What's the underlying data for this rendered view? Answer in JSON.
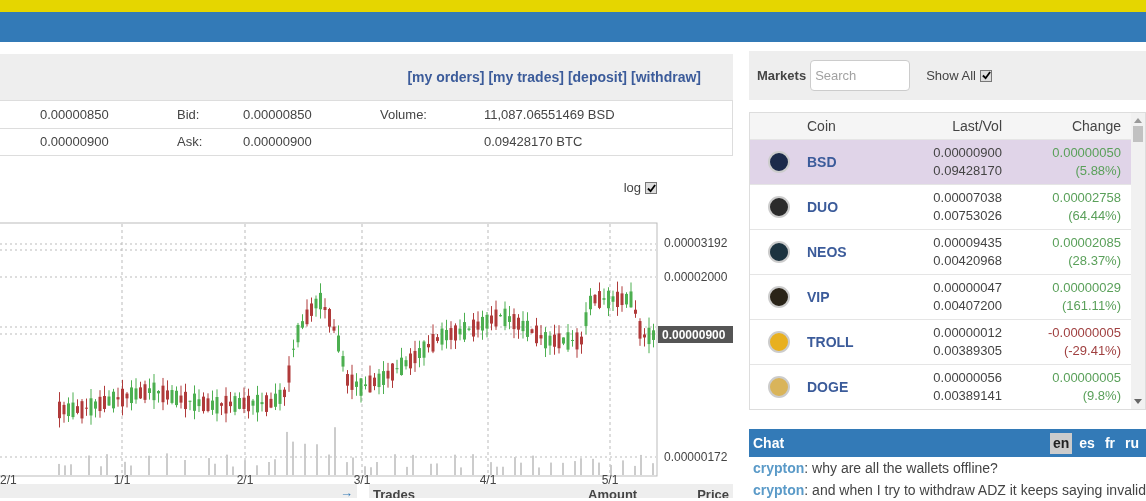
{
  "top_links": [
    {
      "label": "[my orders]"
    },
    {
      "label": "[my trades]"
    },
    {
      "label": "[deposit]"
    },
    {
      "label": "[withdraw]"
    }
  ],
  "ticker_rows": [
    {
      "col_1": "0.00000850",
      "label": "Bid:",
      "value": "0.00000850",
      "label_2": "Volume:",
      "amount": "11,087.06551469 BSD"
    },
    {
      "col_1": "0.00000900",
      "label": "Ask:",
      "value": "0.00000900",
      "label_2": "",
      "amount": "0.09428170 BTC"
    }
  ],
  "chart": {
    "log_label": "log",
    "log_checked": true,
    "y_ticks": [
      "0.00003192",
      "0.00002000",
      "0.00000172"
    ],
    "current_price": "0.00000900",
    "x_ticks": [
      "2/1",
      "1/1",
      "2/1",
      "3/1",
      "4/1",
      "5/1"
    ]
  },
  "bottom_bar": {
    "arrow": "→",
    "columns": [
      "Trades",
      "Amount",
      "Price"
    ]
  },
  "markets": {
    "title": "Markets",
    "search_placeholder": "Search",
    "show_all_label": "Show All",
    "show_all_checked": true
  },
  "coin_table": {
    "columns": [
      "Coin",
      "Last/Vol",
      "Change"
    ],
    "rows": [
      {
        "coin": "BSD",
        "last": "0.00000900",
        "vol": "0.09428170",
        "change": "0.00000050",
        "pct": "(5.88%)",
        "negative": false,
        "selected": true,
        "color": "#1b2a4a"
      },
      {
        "coin": "DUO",
        "last": "0.00007038",
        "vol": "0.00753026",
        "change": "0.00002758",
        "pct": "(64.44%)",
        "negative": false,
        "selected": false,
        "color": "#2b2b2b"
      },
      {
        "coin": "NEOS",
        "last": "0.00009435",
        "vol": "0.00420968",
        "change": "0.00002085",
        "pct": "(28.37%)",
        "negative": false,
        "selected": false,
        "color": "#1c3340"
      },
      {
        "coin": "VIP",
        "last": "0.00000047",
        "vol": "0.00407200",
        "change": "0.00000029",
        "pct": "(161.11%)",
        "negative": false,
        "selected": false,
        "color": "#2a2418"
      },
      {
        "coin": "TROLL",
        "last": "0.00000012",
        "vol": "0.00389305",
        "change": "-0.00000005",
        "pct": "(-29.41%)",
        "negative": true,
        "selected": false,
        "color": "#e8b020"
      },
      {
        "coin": "DOGE",
        "last": "0.00000056",
        "vol": "0.00389141",
        "change": "0.00000005",
        "pct": "(9.8%)",
        "negative": false,
        "selected": false,
        "color": "#d9b45a"
      }
    ]
  },
  "chat": {
    "title": "Chat",
    "languages": [
      {
        "code": "en",
        "selected": true
      },
      {
        "code": "es",
        "selected": false
      },
      {
        "code": "fr",
        "selected": false
      },
      {
        "code": "ru",
        "selected": false
      }
    ],
    "messages": [
      {
        "user": "crypton",
        "text": ": why are all the wallets offline?"
      },
      {
        "user": "crypton",
        "text": ": and when I try to withdraw ADZ it keeps saying invalid"
      }
    ]
  }
}
